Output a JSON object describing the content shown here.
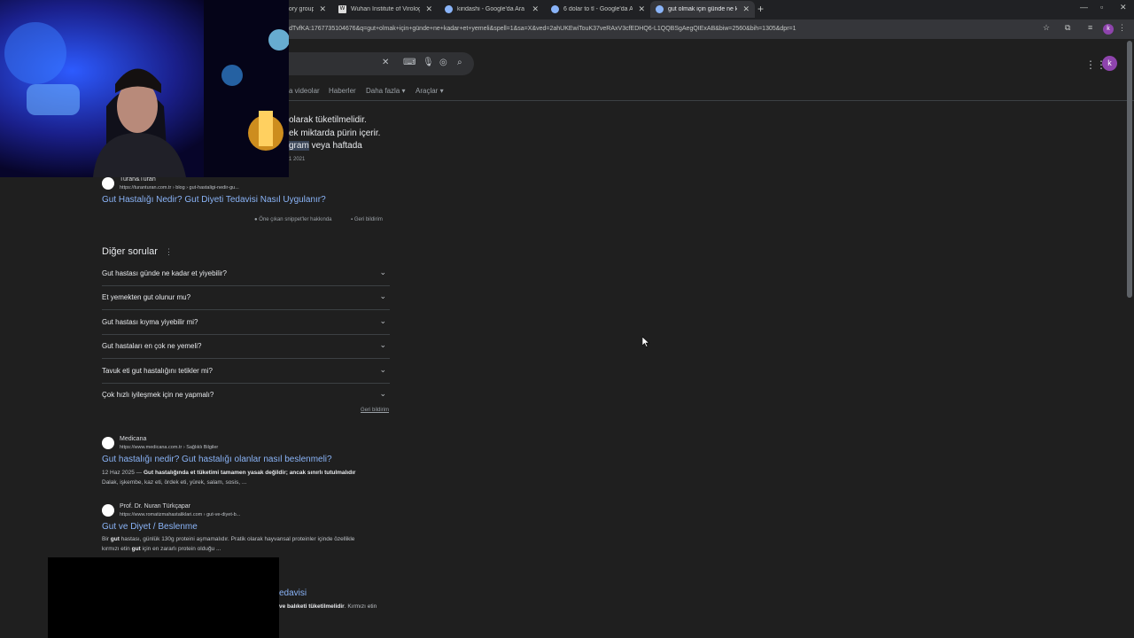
{
  "tabs": [
    {
      "title": "eory group",
      "active": false
    },
    {
      "title": "Wuhan Institute of Virology - Wi",
      "active": false
    },
    {
      "title": "kiridashi - Google'da Ara",
      "active": false
    },
    {
      "title": "6 dolar to tl - Google'da Ara",
      "active": false
    },
    {
      "title": "gut olmak için günde ne kadar",
      "active": true
    }
  ],
  "address_bar": "Z-3p6andTvfKA:1767735104676&q=gut+olmak+için+günde+ne+kadar+et+yemeli&spell=1&sa=X&ved=2ahUKEwiTouK37veRAxV3cfEDHQ6-L1QQBSgAegQIExAB&biw=2560&bih=1305&dpr=1",
  "account_initial": "k",
  "nav_tabs": [
    "a videolar",
    "Haberler",
    "Daha fazla",
    "Araçlar"
  ],
  "featured_snippet": {
    "lines": [
      "olarak tüketilmelidir.",
      "ek miktarda pürin içerir.",
      "gram veya haftada"
    ],
    "highlight": "gram",
    "rest_line3": " veya haftada",
    "date": "1 2021"
  },
  "first_result": {
    "site": "Turan&Turan",
    "url": "https://turanturan.com.tr › blog › gut-hastaligi-nedir-gu...",
    "title": "Gut Hastalığı Nedir? Gut Diyeti Tedavisi Nasıl Uygulanır?",
    "about_snippets": "Öne çıkan snippet'ler hakkında",
    "feedback": "Geri bildirim"
  },
  "people_also_ask": {
    "title": "Diğer sorular",
    "questions": [
      "Gut hastası günde ne kadar et yiyebilir?",
      "Et yemekten gut olunur mu?",
      "Gut hastası kıyma yiyebilir mi?",
      "Gut hastaları en çok ne yemeli?",
      "Tavuk eti gut hastalığını tetikler mi?",
      "Çok hızlı iyileşmek için ne yapmalı?"
    ],
    "feedback": "Geri bildirim"
  },
  "results": [
    {
      "site": "Medicana",
      "url": "https://www.medicana.com.tr › Sağlıklı Bilgiler",
      "title": "Gut hastalığı nedir? Gut hastalığı olanlar nasıl beslenmeli?",
      "date": "12 Haz 2025 —",
      "desc_bold": "Gut hastalığında et tüketimi tamamen yasak değildir; ancak sınırlı tutulmalıdır",
      "desc_line2": "Dalak, işkembe, kaz eti, ördek eti, yürek, salam, sosis, ..."
    },
    {
      "site": "Prof. Dr. Nuran Türkçapar",
      "url": "https://www.romatizmahastaliklari.com › gut-ve-diyet-b...",
      "title": "Gut ve Diyet / Beslenme",
      "desc_pre": "Bir ",
      "desc_b1": "gut",
      "desc_mid": " hastası, günlük 130g proteini aşmamalıdır. Pratik olarak hayvansal proteinler içinde özellikle",
      "desc_line2_pre": "kırmızı etin ",
      "desc_b2": "gut",
      "desc_line2_post": " için en zararlı protein olduğu ..."
    },
    {
      "title": "edavisi",
      "desc_bold": "ve balıketi tüketilmelidir",
      "desc_post": ". Kırmızı etin"
    }
  ]
}
